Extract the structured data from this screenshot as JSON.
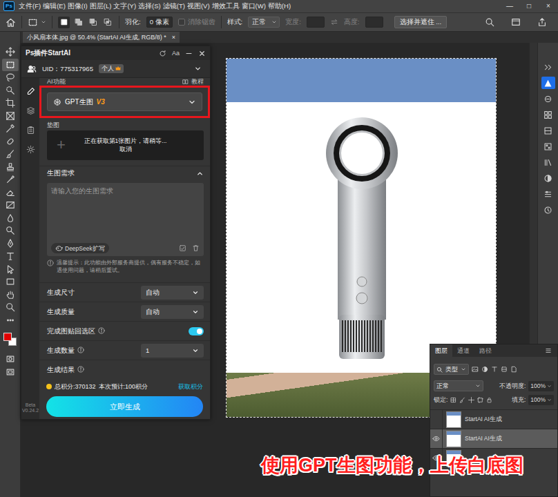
{
  "app": {
    "logo": "Ps"
  },
  "menu": [
    "文件(F)",
    "编辑(E)",
    "图像(I)",
    "图层(L)",
    "文字(Y)",
    "选择(S)",
    "滤镜(T)",
    "视图(V)",
    "增效工具",
    "窗口(W)",
    "帮助(H)"
  ],
  "window_controls": [
    "—",
    "□",
    "×"
  ],
  "options_bar": {
    "selection_modes": [
      {
        "selected": true
      },
      {
        "selected": false
      },
      {
        "selected": false
      },
      {
        "selected": false
      }
    ],
    "feather_label": "羽化:",
    "feather_value": "0 像素",
    "antialias": {
      "label": "消除锯齿",
      "disabled": true
    },
    "style_label": "样式:",
    "style_value": "正常",
    "width_label": "宽度:",
    "height_label": "高度:",
    "size_fields_disabled": true,
    "select_mask": "选择并遮住 ..."
  },
  "tools": [
    {
      "selected": false
    },
    {
      "selected": true
    },
    {
      "selected": false
    },
    {
      "selected": false
    },
    {
      "selected": false
    },
    {
      "selected": false
    },
    {
      "selected": false
    },
    {
      "selected": false
    },
    {
      "selected": false
    },
    {
      "selected": false
    },
    {
      "selected": false
    },
    {
      "selected": false
    },
    {
      "selected": false
    },
    {
      "selected": false
    },
    {
      "selected": false
    },
    {
      "selected": false
    },
    {
      "selected": false
    },
    {
      "selected": false
    },
    {
      "selected": false
    },
    {
      "selected": false
    },
    {
      "selected": false
    },
    {
      "selected": false
    }
  ],
  "colors": {
    "foreground": "#e00000",
    "background": "#ffffff"
  },
  "document_tab": {
    "title": "小风扇本体.jpg @ 50.4% (StartAI AI生成, RGB/8) *",
    "close": "×"
  },
  "document": {
    "selection_active": true
  },
  "plugin": {
    "title": "Ps插件StartAI",
    "font_button": "Aa",
    "uid": "UID：775317965",
    "account_badge": "个人",
    "side_tabs": [
      {
        "selected": true
      },
      {
        "selected": false
      },
      {
        "selected": false
      },
      {
        "selected": false
      }
    ],
    "version_label": "Beta",
    "version": "V0.24.2",
    "function_label": "AI功能",
    "tutorial": "教程",
    "function": {
      "name": "GPT生图",
      "badge": "V3",
      "highlighted": true
    },
    "ref_label": "垫图",
    "upload": {
      "plus": "+",
      "status": "正在获取第1张图片，请稍等...",
      "cancel": "取消"
    },
    "prompt_section": {
      "title": "生图需求",
      "expanded": true,
      "placeholder": "请输入您的生图需求",
      "expand_button": "DeepSeek扩写"
    },
    "tip": "温馨提示：此功能由外部服务商提供，偶有服务不稳定，如遇使用问题，请稍后重试。",
    "settings": [
      {
        "kind": "select",
        "label": "生成尺寸",
        "value": "自动",
        "info": false
      },
      {
        "kind": "select",
        "label": "生成质量",
        "value": "自动",
        "info": false
      },
      {
        "kind": "toggle",
        "label": "完成图贴回选区",
        "info": true,
        "on": true
      },
      {
        "kind": "select",
        "label": "生成数量",
        "value": "1",
        "info": true
      },
      {
        "kind": "heading",
        "label": "生成结果",
        "info": true
      }
    ],
    "points": "总积分:370132",
    "estimate": "本次预计:100积分",
    "get_points": "获取积分",
    "generate": "立即生成"
  },
  "layers_panel": {
    "tabs": [
      {
        "label": "图层",
        "selected": true
      },
      {
        "label": "通道",
        "selected": false
      },
      {
        "label": "路径",
        "selected": false
      }
    ],
    "filter": "类型",
    "blend": "正常",
    "opacity_label": "不透明度:",
    "opacity": "100%",
    "lock_label": "锁定:",
    "fill_label": "填充:",
    "fill": "100%",
    "layers": [
      {
        "name": "StartAI AI生成",
        "visible": false,
        "selected": false
      },
      {
        "name": "StartAI AI生成",
        "visible": true,
        "selected": true
      },
      {
        "visible": true,
        "selected": false
      }
    ]
  },
  "caption": "使用GPT生图功能，上传白底图"
}
